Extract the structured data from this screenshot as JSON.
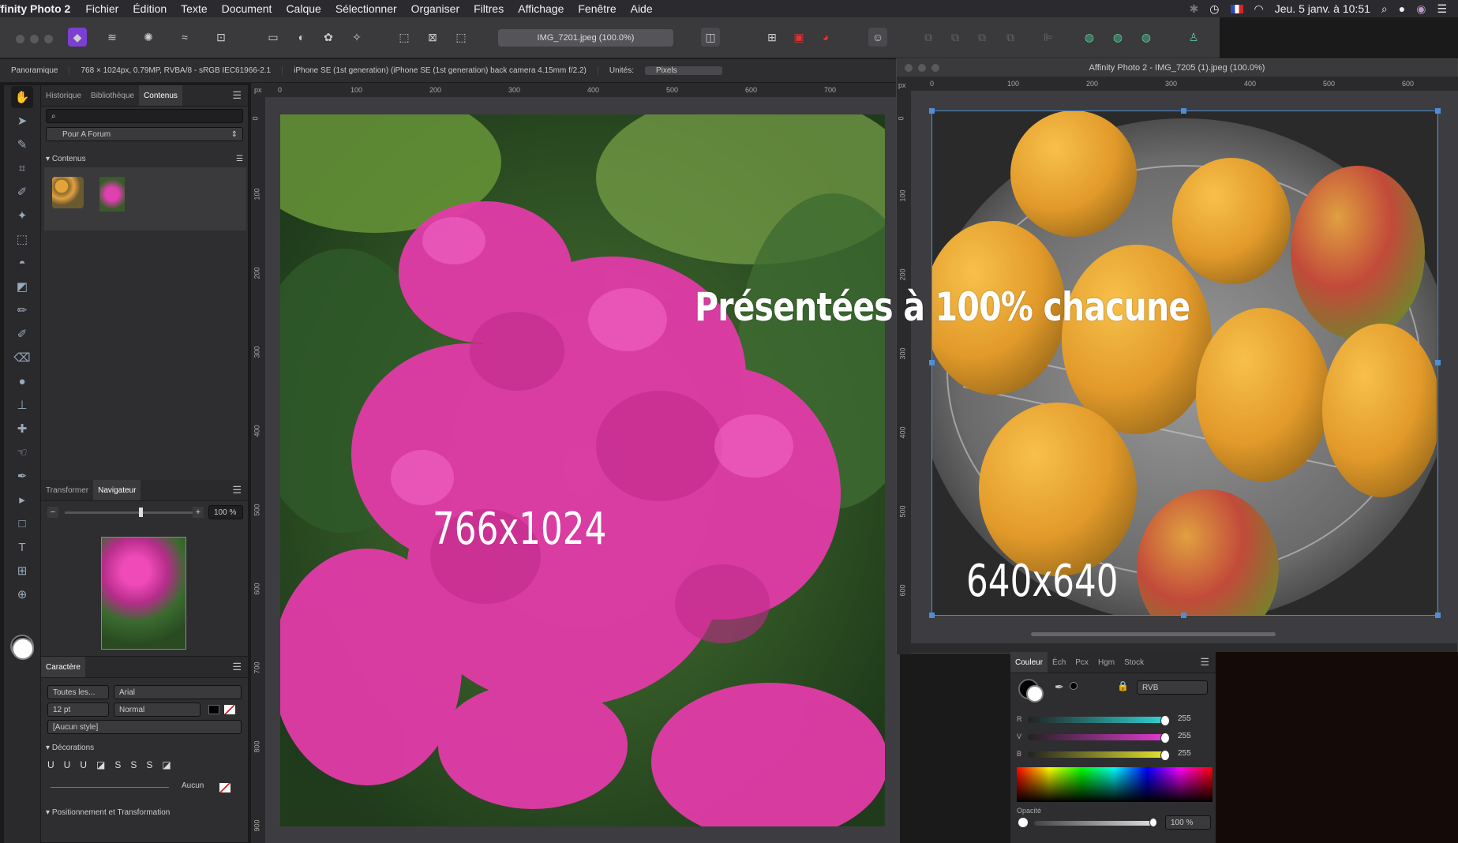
{
  "menubar": {
    "app": "ffinity Photo 2",
    "items": [
      "Fichier",
      "Édition",
      "Texte",
      "Document",
      "Calque",
      "Sélectionner",
      "Organiser",
      "Filtres",
      "Affichage",
      "Fenêtre",
      "Aide"
    ],
    "datetime": "Jeu. 5 janv. à 10:51"
  },
  "toolbar": {
    "doc_title": "IMG_7201.jpeg (100.0%)"
  },
  "contextbar": {
    "mode": "Panoramique",
    "image_info": "768 × 1024px, 0.79MP, RVBA/8 - sRGB IEC61966-2.1",
    "camera_info": "iPhone SE (1st generation) (iPhone SE (1st generation) back camera 4.15mm f/2.2)",
    "units_label": "Unités:",
    "units_value": "Pixels"
  },
  "panel_top": {
    "tabs": [
      "Historique",
      "Bibliothèque",
      "Contenus"
    ],
    "active": "Contenus",
    "search_placeholder": "",
    "category": "Pour A Forum",
    "section": "Contenus"
  },
  "navigator": {
    "tabs": [
      "Transformer",
      "Navigateur"
    ],
    "active": "Navigateur",
    "zoom": "100 %"
  },
  "character": {
    "title": "Caractère",
    "family_scope": "Toutes les...",
    "font": "Arial",
    "size": "12 pt",
    "weight": "Normal",
    "style": "[Aucun style]",
    "decorations": "Décorations",
    "none_label": "Aucun",
    "positioning": "Positionnement et Transformation"
  },
  "ruler_left": {
    "unit": "px",
    "h_ticks": [
      "0",
      "100",
      "200",
      "300",
      "400",
      "500",
      "600",
      "700"
    ],
    "v_ticks": [
      "0",
      "100",
      "200",
      "300",
      "400",
      "500",
      "600",
      "700",
      "800",
      "900"
    ]
  },
  "window2": {
    "title": "Affinity Photo 2 - IMG_7205 (1).jpeg (100.0%)",
    "unit": "px",
    "h_ticks": [
      "0",
      "100",
      "200",
      "300",
      "400",
      "500",
      "600"
    ],
    "v_ticks": [
      "0",
      "100",
      "200",
      "300",
      "400",
      "500",
      "600"
    ]
  },
  "overlay": {
    "headline": "Présentées à 100% chacune",
    "left_size": "766x1024",
    "right_size": "640x640"
  },
  "color_panel": {
    "tabs": [
      "Couleur",
      "Éch",
      "Pcx",
      "Hgm",
      "Stock"
    ],
    "active": "Couleur",
    "model": "RVB",
    "channels": [
      {
        "label": "R",
        "value": "255",
        "color": "#2fd6d6"
      },
      {
        "label": "V",
        "value": "255",
        "color": "#e23bd2"
      },
      {
        "label": "B",
        "value": "255",
        "color": "#e6e62e"
      }
    ],
    "opacity_label": "Opacité",
    "opacity_value": "100 %"
  }
}
